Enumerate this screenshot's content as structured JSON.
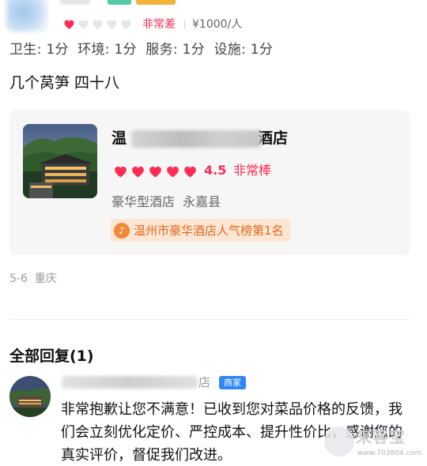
{
  "review": {
    "stars_filled": 1,
    "stars_total": 5,
    "rating_word": "非常差",
    "price": "¥1000/人",
    "subscores": "卫生: 1分  环境: 1分  服务: 1分  设施: 1分",
    "body": "几个莴笋 四十八",
    "date_location": "5-6  重庆"
  },
  "hotel": {
    "name_prefix": "温",
    "name_suffix": "酒店",
    "hearts": 5,
    "score": "4.5",
    "score_word": "非常棒",
    "type_location": "豪华型酒店  永嘉县",
    "rank": "温州市豪华酒店人气榜第1名",
    "rank_icon": "douyin-icon"
  },
  "replies": {
    "title": "全部回复(1)",
    "merchant_name_tail": "店",
    "merchant_badge": "商家",
    "reply_text": "非常抱歉让您不满意！已收到您对菜品价格的反馈，我们会立刻优化定价、严控成本、提升性价比，感谢您的真实评价，督促我们改进。"
  },
  "watermark": {
    "text": "来客宝",
    "url": "www.703804.com"
  },
  "colors": {
    "accent": "#ff2d55",
    "heart_empty": "#e6e6e6",
    "rank_bg": "#fde6d4",
    "rank_text": "#e06a1c",
    "merchant_badge": "#2f86f6"
  }
}
